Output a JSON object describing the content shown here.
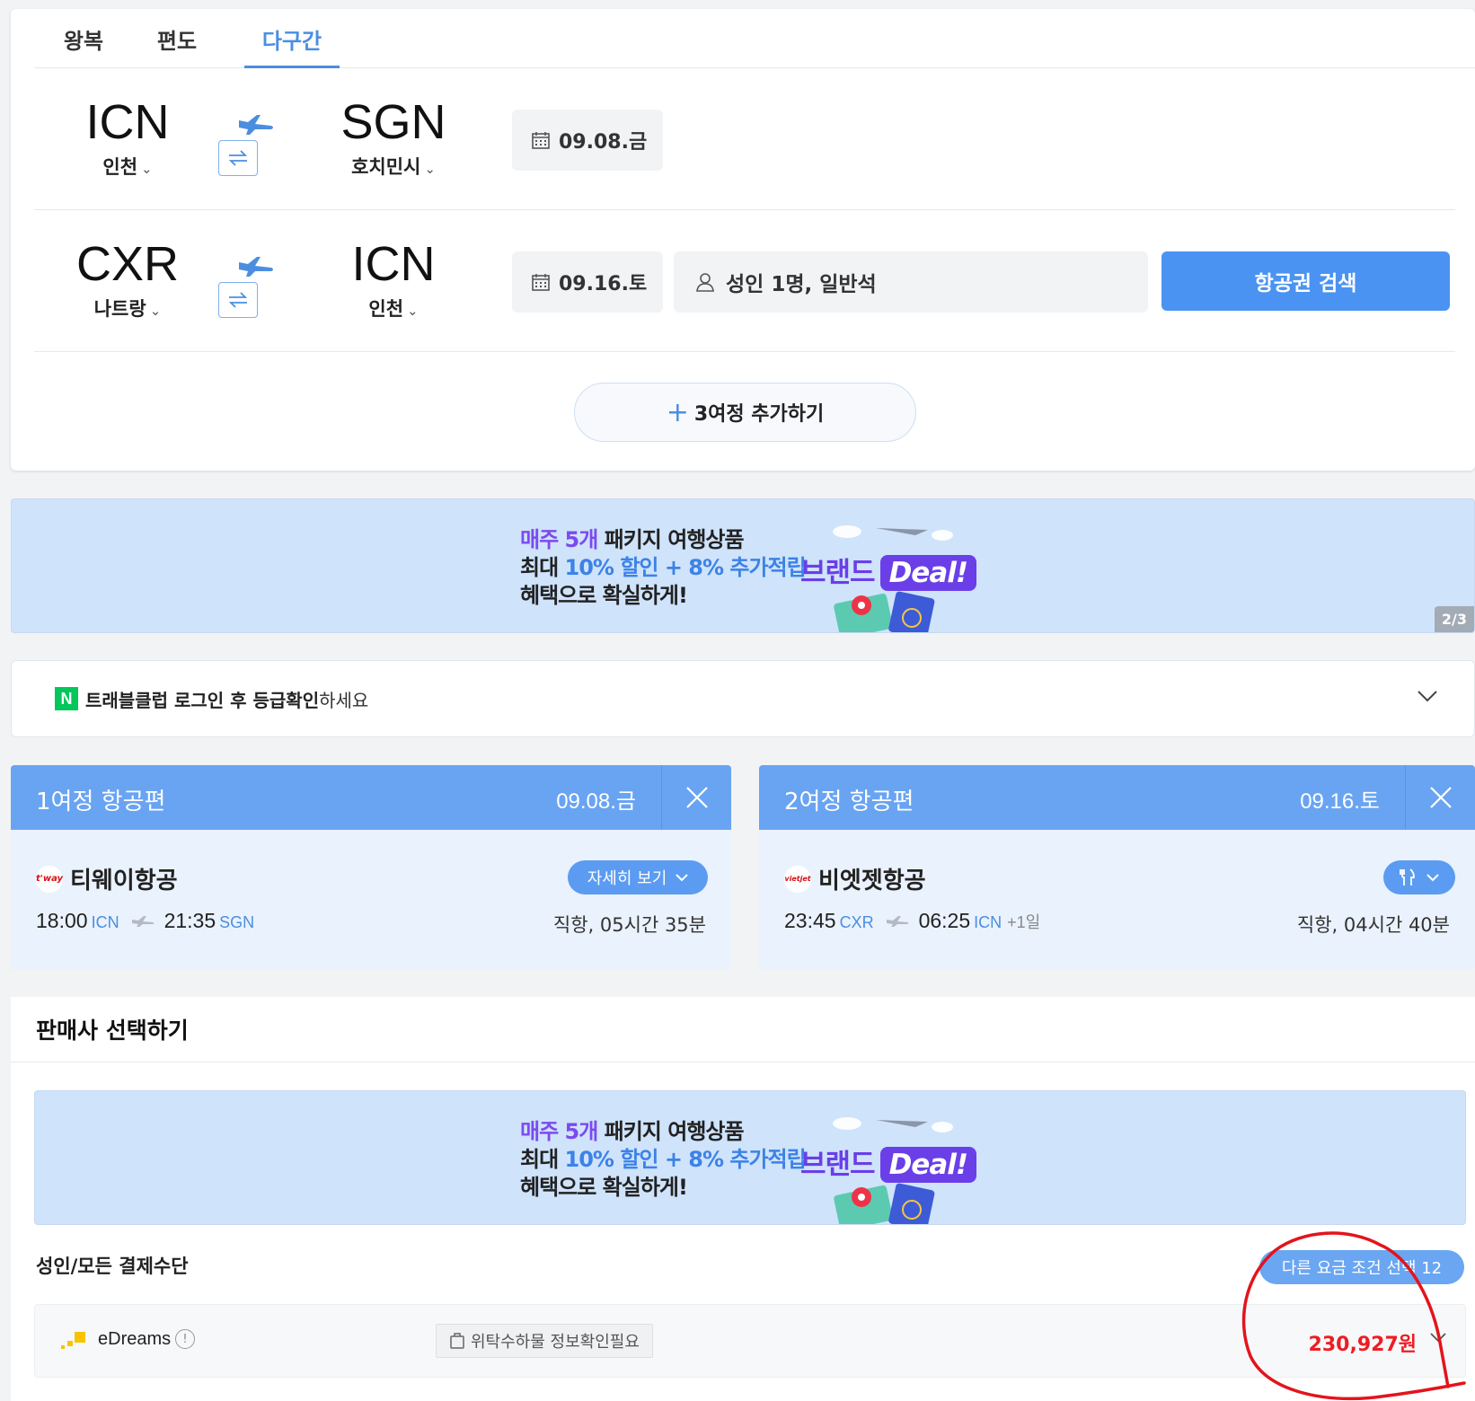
{
  "tabs": [
    {
      "label": "왕복",
      "active": false
    },
    {
      "label": "편도",
      "active": false
    },
    {
      "label": "다구간",
      "active": true
    }
  ],
  "legs_form": [
    {
      "from_code": "ICN",
      "from_city": "인천",
      "to_code": "SGN",
      "to_city": "호치민시",
      "date": "09.08.금"
    },
    {
      "from_code": "CXR",
      "from_city": "나트랑",
      "to_code": "ICN",
      "to_city": "인천",
      "date": "09.16.토"
    }
  ],
  "passengers": "성인 1명, 일반석",
  "search_button": "항공권 검색",
  "add_leg": "3여정 추가하기",
  "banner": {
    "line1_a": "매주 5개",
    "line1_b": " 패키지 여행상품",
    "line2_a": "최대 ",
    "line2_b": "10% 할인 + 8% 추가적립",
    "line3": "혜택으로 확실하게!",
    "brand": "브랜드",
    "deal": "Deal!",
    "pager": "2/3"
  },
  "login": {
    "logo": "N",
    "bold": "트래블클럽 로그인 후 등급확인",
    "rest": " 하세요"
  },
  "selected_legs": [
    {
      "title": "1여정 항공편",
      "date": "09.08.금",
      "airline": "티웨이항공",
      "logo_text": "t'way",
      "pill": "자세히 보기",
      "dep_time": "18:00",
      "dep_ap": "ICN",
      "arr_time": "21:35",
      "arr_ap": "SGN",
      "plus_day": "",
      "duration": "직항, 05시간 35분"
    },
    {
      "title": "2여정 항공편",
      "date": "09.16.토",
      "airline": "비엣젯항공",
      "logo_text": "vietjet",
      "pill": "",
      "dep_time": "23:45",
      "dep_ap": "CXR",
      "arr_time": "06:25",
      "arr_ap": "ICN",
      "plus_day": "+1일",
      "duration": "직항, 04시간 40분"
    }
  ],
  "seller": {
    "title": "판매사 선택하기",
    "pay_label": "성인/모든 결제수단",
    "other_options": "다른 요금 조건 선택 12",
    "vendor": "eDreams",
    "baggage": "위탁수하물 정보확인필요",
    "price": "230,927원"
  },
  "colors": {
    "accent": "#4b8ee0",
    "header_blue": "#69a4f2",
    "price_red": "#ee1d23",
    "banner_bg": "#cfe3fb",
    "brand_purple": "#6a3fe8"
  }
}
